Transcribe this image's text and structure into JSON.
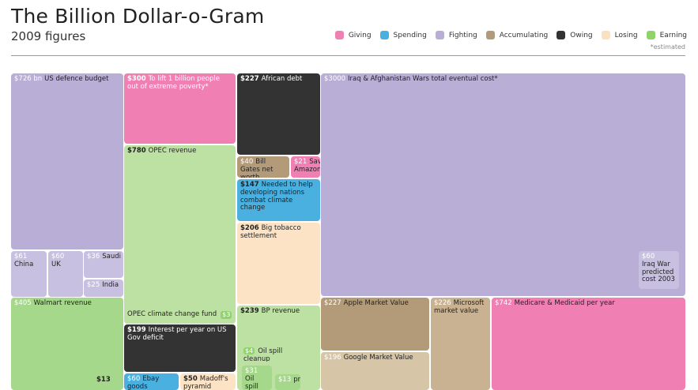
{
  "header": {
    "title": "The Billion Dollar-o-Gram",
    "subtitle": "2009 figures",
    "estimated_note": "*estimated"
  },
  "legend": [
    {
      "label": "Giving",
      "color": "#f07fb3"
    },
    {
      "label": "Spending",
      "color": "#4ab0e0"
    },
    {
      "label": "Fighting",
      "color": "#b9aed6"
    },
    {
      "label": "Accumulating",
      "color": "#b39b79"
    },
    {
      "label": "Owing",
      "color": "#333333"
    },
    {
      "label": "Losing",
      "color": "#fde0c0"
    },
    {
      "label": "Earning",
      "color": "#8fd36b"
    }
  ],
  "chart_data": {
    "type": "treemap",
    "title": "The Billion Dollar-o-Gram",
    "subtitle": "2009 figures",
    "items": [
      {
        "value_label": "$726 bn",
        "value": 726,
        "label": "US defence budget",
        "category": "Fighting"
      },
      {
        "value_label": "$61",
        "value": 61,
        "label": "China",
        "category": "Fighting"
      },
      {
        "value_label": "$60",
        "value": 60,
        "label": "UK",
        "category": "Fighting"
      },
      {
        "value_label": "$36",
        "value": 36,
        "label": "Saudi",
        "category": "Fighting"
      },
      {
        "value_label": "$25",
        "value": 25,
        "label": "India",
        "category": "Fighting"
      },
      {
        "value_label": "$405",
        "value": 405,
        "label": "Walmart revenue",
        "category": "Earning"
      },
      {
        "value_label": "$13",
        "value": 13,
        "label": "",
        "category": "Earning"
      },
      {
        "value_label": "$300",
        "value": 300,
        "label": "To lift 1 billion people out of extreme poverty*",
        "category": "Giving"
      },
      {
        "value_label": "$780",
        "value": 780,
        "label": "OPEC revenue",
        "category": "Earning"
      },
      {
        "value_label": "$3",
        "value": 3,
        "label": "OPEC climate change fund",
        "category": "Giving"
      },
      {
        "value_label": "$199",
        "value": 199,
        "label": "Interest per year on US Gov deficit",
        "category": "Owing"
      },
      {
        "value_label": "$60",
        "value": 60,
        "label": "Ebay goods",
        "category": "Spending"
      },
      {
        "value_label": "$50",
        "value": 50,
        "label": "Madoff's pyramid",
        "category": "Losing"
      },
      {
        "value_label": "$227",
        "value": 227,
        "label": "African debt",
        "category": "Owing"
      },
      {
        "value_label": "$40",
        "value": 40,
        "label": "Bill Gates net worth",
        "category": "Accumulating"
      },
      {
        "value_label": "$21",
        "value": 21,
        "label": "Save Amazon",
        "category": "Giving"
      },
      {
        "value_label": "$147",
        "value": 147,
        "label": "Needed to help developing nations combat climate change",
        "category": "Spending"
      },
      {
        "value_label": "$206",
        "value": 206,
        "label": "Big tobacco settlement",
        "category": "Losing"
      },
      {
        "value_label": "$239",
        "value": 239,
        "label": "BP revenue",
        "category": "Earning"
      },
      {
        "value_label": "$4",
        "value": 4,
        "label": "Oil spill cleanup",
        "category": "Earning"
      },
      {
        "value_label": "$31",
        "value": 31,
        "label": "Oil spill fine*",
        "category": "Earning"
      },
      {
        "value_label": "$13",
        "value": 13,
        "label": "profit",
        "category": "Earning"
      },
      {
        "value_label": "$3000",
        "value": 3000,
        "label": "Iraq & Afghanistan Wars total eventual cost*",
        "category": "Fighting"
      },
      {
        "value_label": "$60",
        "value": 60,
        "label": "Iraq War predicted cost 2003",
        "category": "Fighting"
      },
      {
        "value_label": "$227",
        "value": 227,
        "label": "Apple Market Value",
        "category": "Accumulating"
      },
      {
        "value_label": "$226",
        "value": 226,
        "label": "Microsoft market value",
        "category": "Accumulating"
      },
      {
        "value_label": "$196",
        "value": 196,
        "label": "Google Market Value",
        "category": "Accumulating"
      },
      {
        "value_label": "$742",
        "value": 742,
        "label": "Medicare & Medicaid per year",
        "category": "Giving"
      }
    ]
  }
}
